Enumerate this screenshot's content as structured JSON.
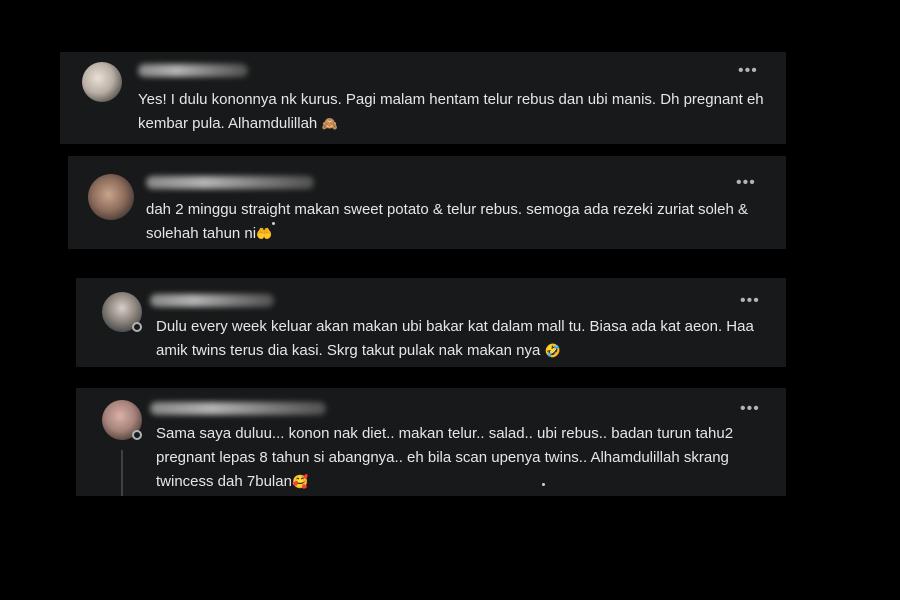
{
  "comments": [
    {
      "text": "Yes! I dulu kononnya nk kurus. Pagi malam hentam telur rebus dan ubi manis. Dh pregnant eh kembar pula. Alhamdulillah",
      "emoji": "🙈",
      "more_icon": "ellipsis-icon"
    },
    {
      "text": "dah 2 minggu straight makan sweet potato & telur rebus. semoga ada rezeki zuriat soleh & solehah tahun ni",
      "emoji": "🤲",
      "more_icon": "ellipsis-icon"
    },
    {
      "text": "Dulu every week keluar akan makan ubi bakar kat dalam mall tu. Biasa ada kat aeon. Haa amik twins terus dia kasi. Skrg takut pulak nak makan nya",
      "emoji": "🤣",
      "more_icon": "ellipsis-icon"
    },
    {
      "text": "Sama saya duluu... konon nak diet.. makan telur.. salad.. ubi rebus.. badan turun tahu2 pregnant lepas 8 tahun si abangnya.. eh bila scan upenya twins.. Alhamdulillah skrang twincess dah 7bulan",
      "emoji": "🥰",
      "more_icon": "ellipsis-icon"
    }
  ],
  "colors": {
    "background": "#000000",
    "card": "#18191a",
    "text": "#e4e6eb",
    "muted": "#b0b3b8"
  }
}
